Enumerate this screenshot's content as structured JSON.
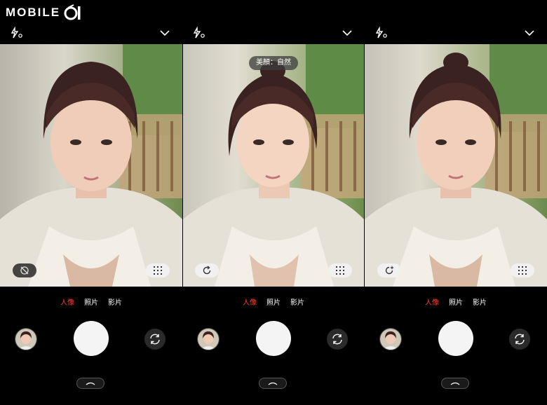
{
  "watermark": {
    "text": "MOBILE",
    "logo": "01"
  },
  "panels": [
    {
      "top_bar": {
        "flash_icon": "flash-off-icon",
        "collapse_icon": "chevron-down-icon"
      },
      "viewfinder": {
        "badge": "",
        "left_button_icon": "beauty-off-icon",
        "right_button_icon": "grid-icon"
      },
      "modes": [
        {
          "label": "人像",
          "active": true
        },
        {
          "label": "照片",
          "active": false
        },
        {
          "label": "影片",
          "active": false
        }
      ]
    },
    {
      "top_bar": {
        "flash_icon": "flash-off-icon",
        "collapse_icon": "chevron-down-icon"
      },
      "viewfinder": {
        "badge": "美顏：自然",
        "left_button_icon": "refresh-icon",
        "right_button_icon": "grid-icon"
      },
      "modes": [
        {
          "label": "人像",
          "active": true
        },
        {
          "label": "照片",
          "active": false
        },
        {
          "label": "影片",
          "active": false
        }
      ]
    },
    {
      "top_bar": {
        "flash_icon": "flash-off-icon",
        "collapse_icon": "chevron-down-icon"
      },
      "viewfinder": {
        "badge": "",
        "left_button_icon": "sparkle-refresh-icon",
        "right_button_icon": "grid-icon"
      },
      "modes": [
        {
          "label": "人像",
          "active": true
        },
        {
          "label": "照片",
          "active": false
        },
        {
          "label": "影片",
          "active": false
        }
      ]
    }
  ],
  "colors": {
    "active_mode": "#ff3b30",
    "background": "#000000",
    "shutter": "#f4f4f4"
  }
}
